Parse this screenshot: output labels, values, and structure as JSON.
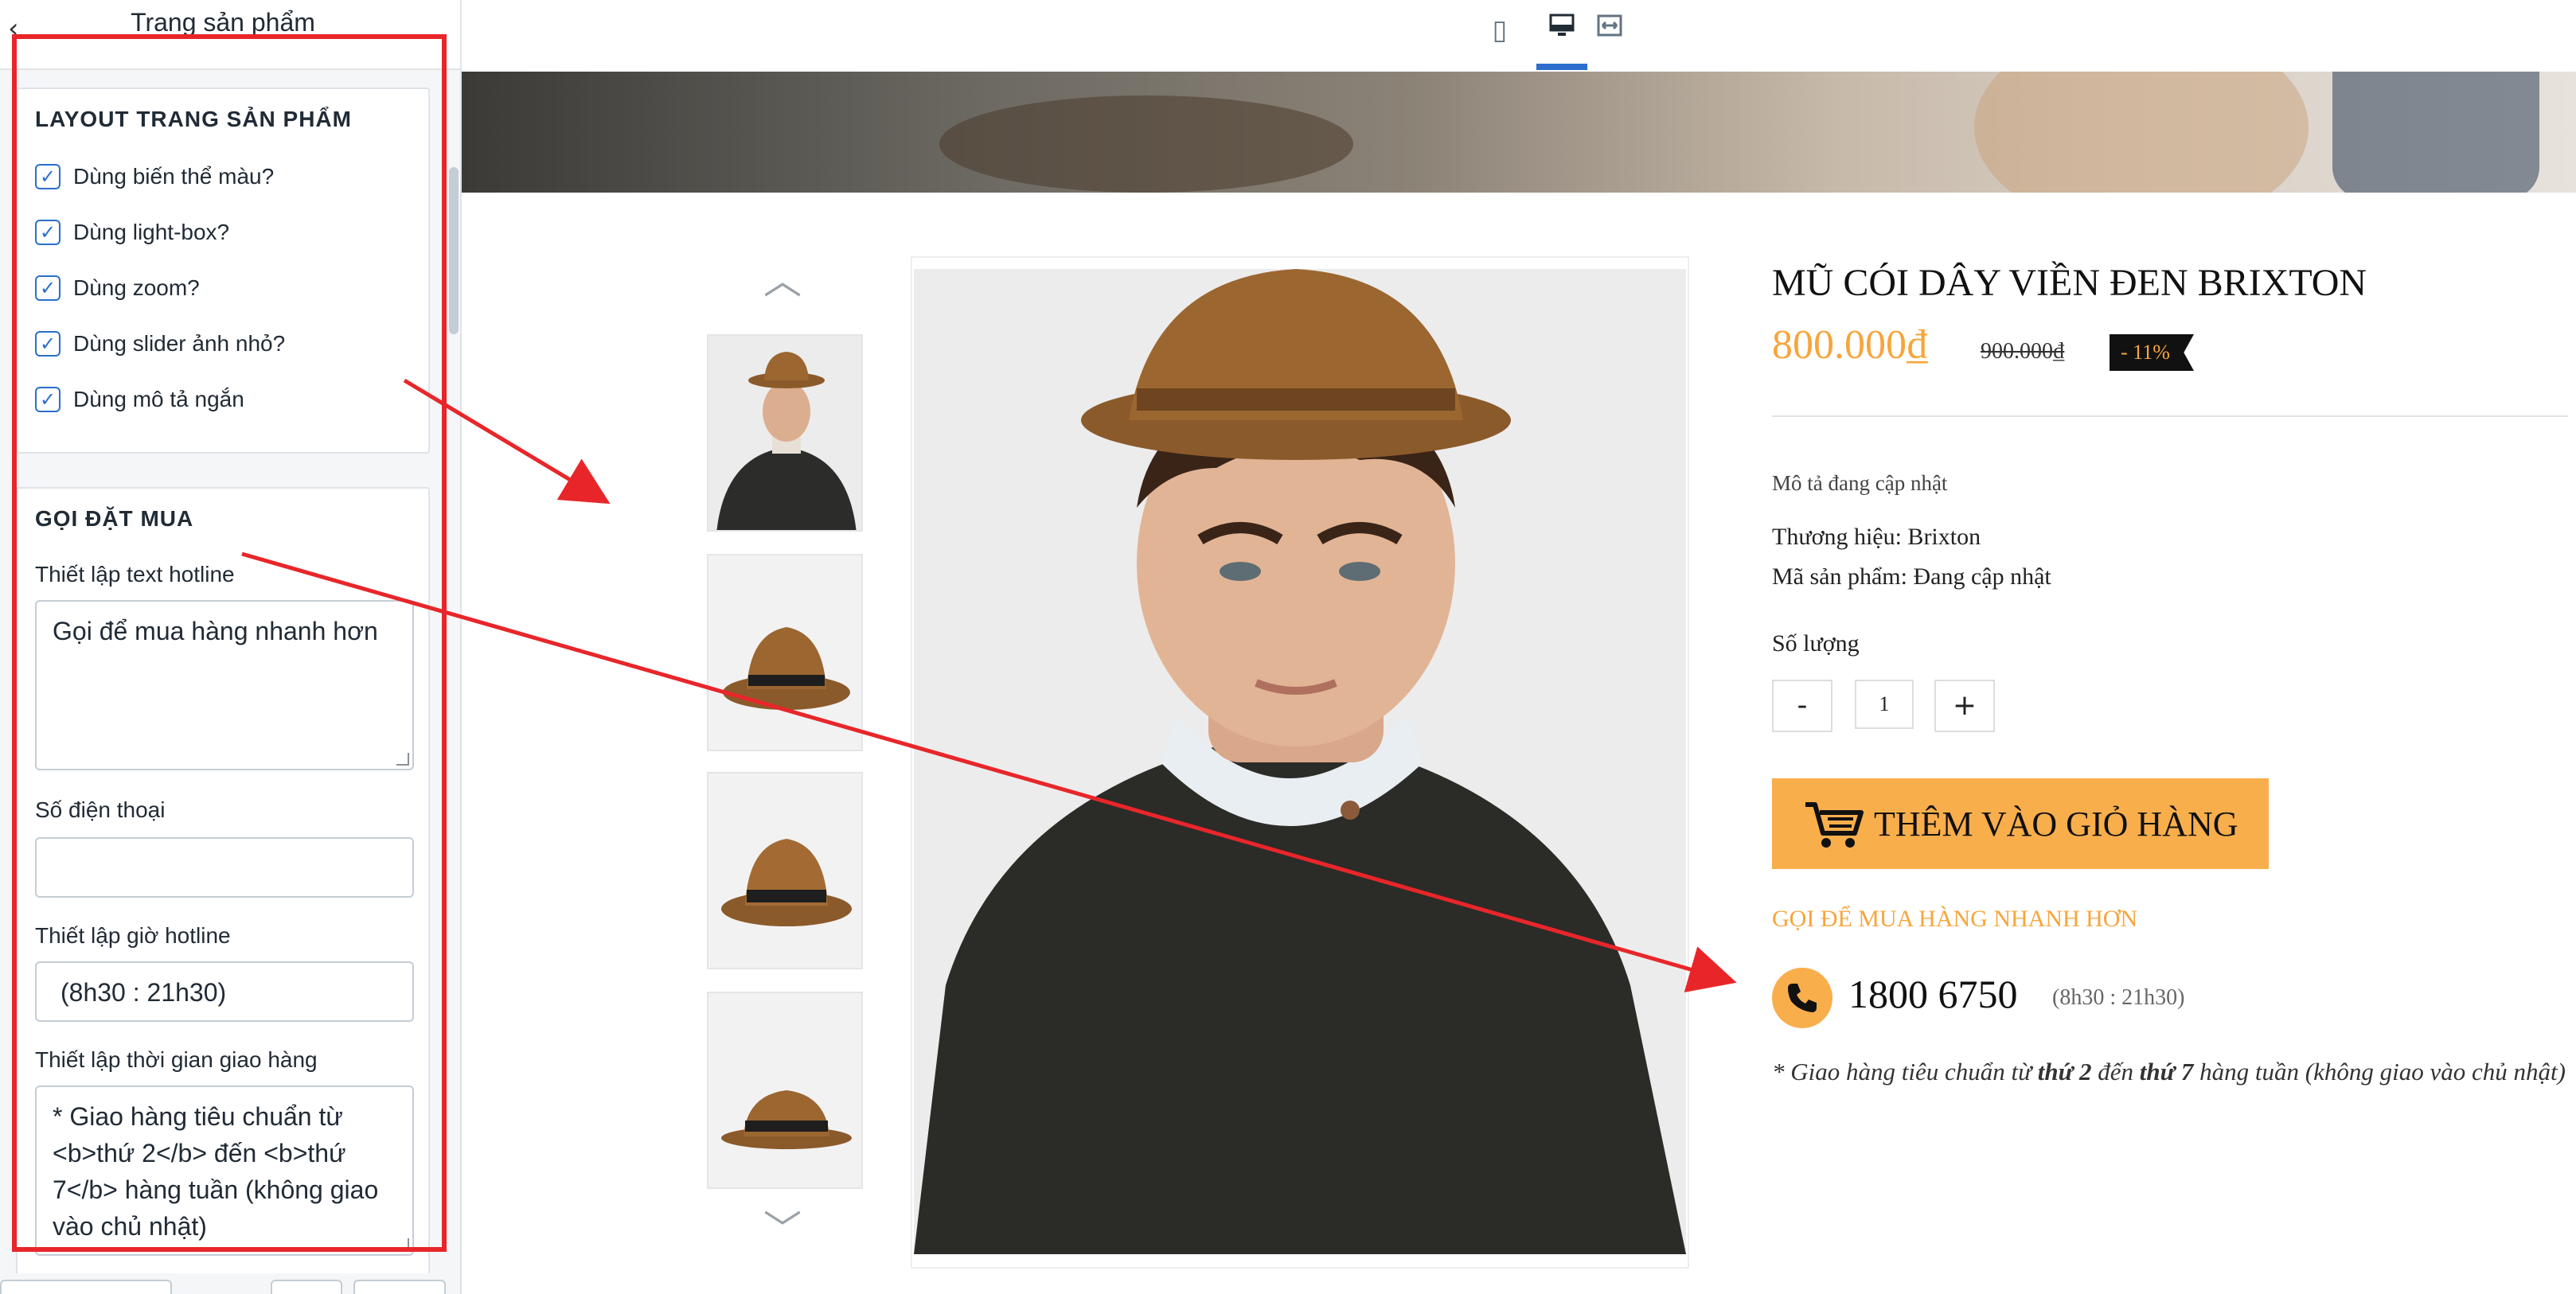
{
  "sidebar": {
    "title": "Trang sản phẩm",
    "back_icon": "chevron-left-icon",
    "layout_section": {
      "title": "LAYOUT TRANG SẢN PHẨM",
      "checkboxes": [
        {
          "label": "Dùng biến thể màu?",
          "checked": true
        },
        {
          "label": "Dùng light-box?",
          "checked": true
        },
        {
          "label": "Dùng zoom?",
          "checked": true
        },
        {
          "label": "Dùng slider ảnh nhỏ?",
          "checked": true
        },
        {
          "label": "Dùng mô tả ngắn",
          "checked": true
        }
      ]
    },
    "call_section": {
      "title": "GỌI ĐẶT MUA",
      "hotline_text_label": "Thiết lập text hotline",
      "hotline_text_value": "Gọi để mua hàng nhanh hơn",
      "phone_label": "Số điện thoại",
      "phone_value": "",
      "hotline_hours_label": "Thiết lập giờ hotline",
      "hotline_hours_value": "(8h30 : 21h30)",
      "delivery_label": "Thiết lập thời gian giao hàng",
      "delivery_value": "* Giao hàng tiêu chuẩn từ <b>thứ 2</b> đến <b>thứ 7</b> hàng tuần (không giao vào chủ nhật)"
    }
  },
  "toolbar": {
    "devices": [
      {
        "icon": "mobile-icon",
        "active": false
      },
      {
        "icon": "desktop-icon",
        "active": true
      },
      {
        "icon": "full-width-icon",
        "active": false
      }
    ]
  },
  "product": {
    "title": "MŨ CÓI DÂY VIỀN ĐEN BRIXTON",
    "price": "800.000₫",
    "old_price": "900.000₫",
    "discount": "- 11%",
    "description": "Mô tả đang cập nhật",
    "brand_line": "Thương hiệu: Brixton",
    "sku_line": "Mã sản phẩm: Đang cập nhật",
    "quantity_label": "Số lượng",
    "quantity_value": "1",
    "minus": "-",
    "plus": "+",
    "add_to_cart": "THÊM VÀO GIỎ HÀNG",
    "call_title": "GỌI ĐỂ MUA HÀNG NHANH HƠN",
    "phone": "1800 6750",
    "hours": "(8h30 : 21h30)",
    "delivery_prefix": "* Giao hàng tiêu chuẩn từ ",
    "delivery_day1": "thứ 2",
    "delivery_mid": " đến ",
    "delivery_day2": "thứ 7",
    "delivery_suffix": " hàng tuần (không giao vào chủ nhật)"
  },
  "colors": {
    "accent_orange": "#f9ae4c",
    "price_orange": "#f7a53c",
    "annotation_red": "#e8262a",
    "checkbox_blue": "#2c6ecb"
  }
}
